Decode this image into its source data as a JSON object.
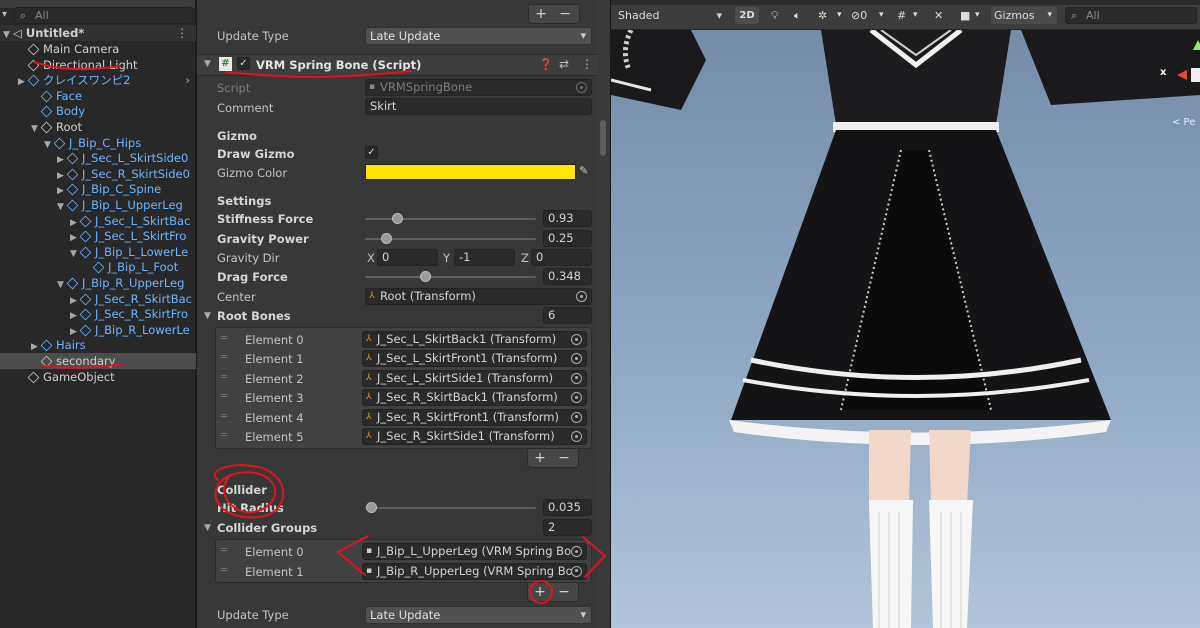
{
  "hierarchy": {
    "search_placeholder": "All",
    "scene": "Untitled*",
    "items": [
      "Main Camera",
      "Directional Light",
      "クレイスワンピ2",
      "Face",
      "Body",
      "Root",
      "J_Bip_C_Hips",
      "J_Sec_L_SkirtSide0",
      "J_Sec_R_SkirtSide0",
      "J_Bip_C_Spine",
      "J_Bip_L_UpperLeg",
      "J_Sec_L_SkirtBac",
      "J_Sec_L_SkirtFro",
      "J_Bip_L_LowerLe",
      "J_Bip_L_Foot",
      "J_Bip_R_UpperLeg",
      "J_Sec_R_SkirtBac",
      "J_Sec_R_SkirtFro",
      "J_Bip_R_LowerLe",
      "Hairs",
      "secondary",
      "GameObject"
    ]
  },
  "inspector": {
    "update_type_label": "Update Type",
    "update_type_value": "Late Update",
    "component_title": "VRM Spring Bone (Script)",
    "script_label": "Script",
    "script_value": "VRMSpringBone",
    "comment_label": "Comment",
    "comment_value": "Skirt",
    "gizmo_header": "Gizmo",
    "draw_gizmo_label": "Draw Gizmo",
    "gizmo_color_label": "Gizmo Color",
    "gizmo_color": "#ffe600",
    "settings_header": "Settings",
    "stiffness_label": "Stiffness Force",
    "stiffness_value": "0.93",
    "stiffness_frac": 0.186,
    "gravity_power_label": "Gravity Power",
    "gravity_power_value": "0.25",
    "gravity_power_frac": 0.125,
    "gravity_dir_label": "Gravity Dir",
    "gx_label": "X",
    "gx": "0",
    "gy_label": "Y",
    "gy": "-1",
    "gz_label": "Z",
    "gz": "0",
    "drag_label": "Drag Force",
    "drag_value": "0.348",
    "drag_frac": 0.348,
    "center_label": "Center",
    "center_value": "Root (Transform)",
    "root_bones_label": "Root Bones",
    "root_bones_count": "6",
    "root_bones": [
      {
        "label": "Element 0",
        "value": "J_Sec_L_SkirtBack1 (Transform)"
      },
      {
        "label": "Element 1",
        "value": "J_Sec_L_SkirtFront1 (Transform)"
      },
      {
        "label": "Element 2",
        "value": "J_Sec_L_SkirtSide1 (Transform)"
      },
      {
        "label": "Element 3",
        "value": "J_Sec_R_SkirtBack1 (Transform)"
      },
      {
        "label": "Element 4",
        "value": "J_Sec_R_SkirtFront1 (Transform)"
      },
      {
        "label": "Element 5",
        "value": "J_Sec_R_SkirtSide1 (Transform)"
      }
    ],
    "collider_header": "Collider",
    "hit_radius_label": "Hit Radius",
    "hit_radius_value": "0.035",
    "hit_radius_frac": 0.035,
    "collider_groups_label": "Collider Groups",
    "collider_groups_count": "2",
    "collider_groups": [
      {
        "label": "Element 0",
        "value": "J_Bip_L_UpperLeg (VRM Spring Bo"
      },
      {
        "label": "Element 1",
        "value": "J_Bip_R_UpperLeg (VRM Spring Bo"
      }
    ],
    "update_type2_label": "Update Type",
    "update_type2_value": "Late Update",
    "plus": "+",
    "minus": "−"
  },
  "scene": {
    "shading": "Shaded",
    "mode_2d": "2D",
    "gizmos": "Gizmos",
    "search_placeholder": "All",
    "axis_x": "x",
    "persp": "< Pe"
  },
  "colors": {
    "annotation": "#e0141e",
    "selection": "#4d4d4d",
    "prefab_blue": "#6eb4ff"
  }
}
